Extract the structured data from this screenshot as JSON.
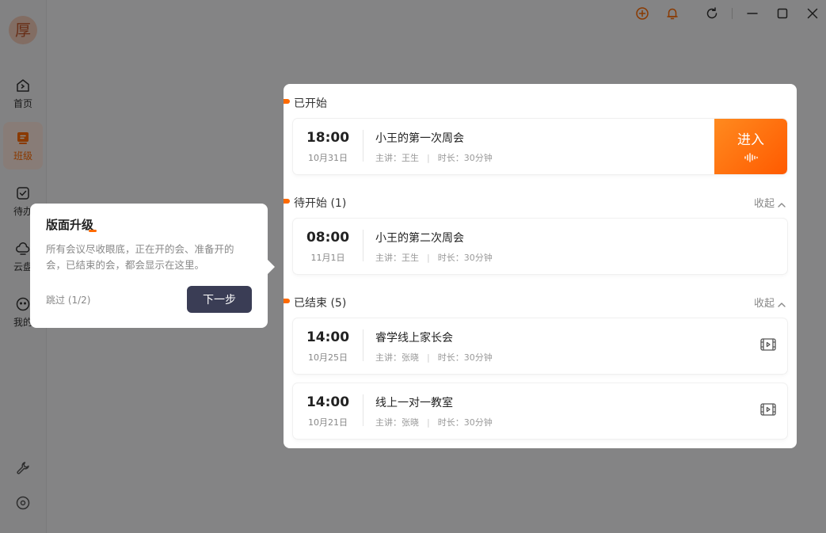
{
  "app": {
    "avatar_text": "厚"
  },
  "sidebar": {
    "items": [
      {
        "label": "首页",
        "icon": "home-icon"
      },
      {
        "label": "班级",
        "icon": "class-icon"
      },
      {
        "label": "待办",
        "icon": "todo-icon"
      },
      {
        "label": "云盘",
        "icon": "cloud-disk-icon"
      },
      {
        "label": "我的",
        "icon": "profile-icon"
      }
    ],
    "bottom_icons": [
      "wrench-icon",
      "settings-circle-icon"
    ]
  },
  "titlebar": {
    "icons": [
      "add-circle-icon",
      "bell-icon",
      "refresh-icon",
      "minimize-icon",
      "maximize-icon",
      "close-icon"
    ],
    "accent_color": "#ff6a00"
  },
  "sections": {
    "started": {
      "title": "已开始",
      "meetings": [
        {
          "time": "18:00",
          "date": "10月31日",
          "title": "小王的第一次周会",
          "host": "主讲：王生",
          "duration": "时长：30分钟",
          "action": "进入"
        }
      ]
    },
    "upcoming": {
      "title": "待开始 (1)",
      "collapse_label": "收起",
      "meetings": [
        {
          "time": "08:00",
          "date": "11月1日",
          "title": "小王的第二次周会",
          "host": "主讲：王生",
          "duration": "时长：30分钟"
        }
      ]
    },
    "ended": {
      "title": "已结束 (5)",
      "collapse_label": "收起",
      "meetings": [
        {
          "time": "14:00",
          "date": "10月25日",
          "title": "睿学线上家长会",
          "host": "主讲：张晓",
          "duration": "时长：30分钟"
        },
        {
          "time": "14:00",
          "date": "10月21日",
          "title": "线上一对一教室",
          "host": "主讲：张晓",
          "duration": "时长：30分钟"
        }
      ]
    }
  },
  "tooltip": {
    "title": "版面升级",
    "text": "所有会议尽收眼底，正在开的会、准备开的会，已结束的会，都会显示在这里。",
    "skip_label": "跳过 (1/2)",
    "next_label": "下一步"
  }
}
